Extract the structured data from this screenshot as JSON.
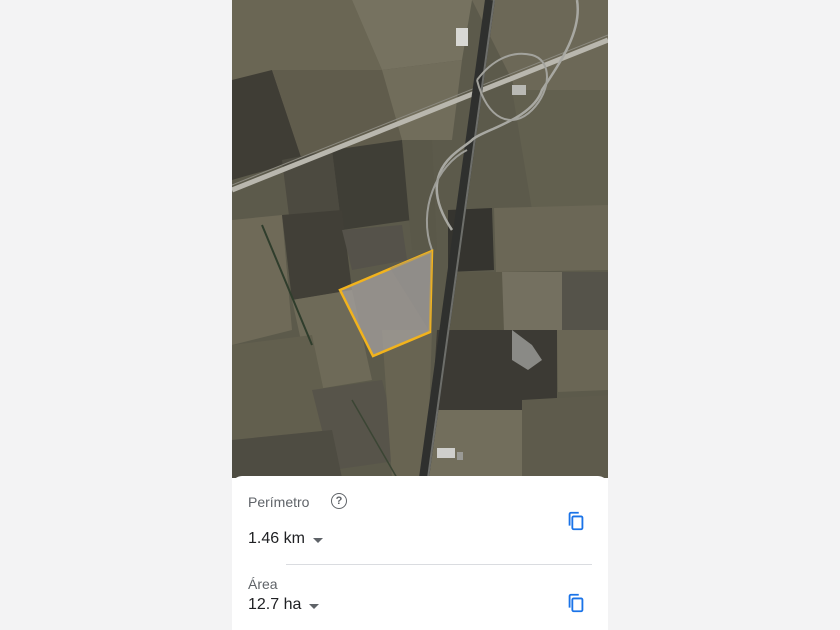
{
  "colors": {
    "measure_outline": "#f2b31d",
    "accent_icon": "#1a73e8",
    "label_text": "#5f6368",
    "value_text": "#202124"
  },
  "map": {
    "view": "satellite",
    "measured_area_shape": "quadrilateral field outline"
  },
  "perimeter": {
    "label": "Perímetro",
    "value": "1.46 km",
    "help_icon": "question-circle-icon",
    "copy_icon": "copy-icon"
  },
  "area": {
    "label": "Área",
    "value": "12.7 ha",
    "copy_icon": "copy-icon"
  }
}
